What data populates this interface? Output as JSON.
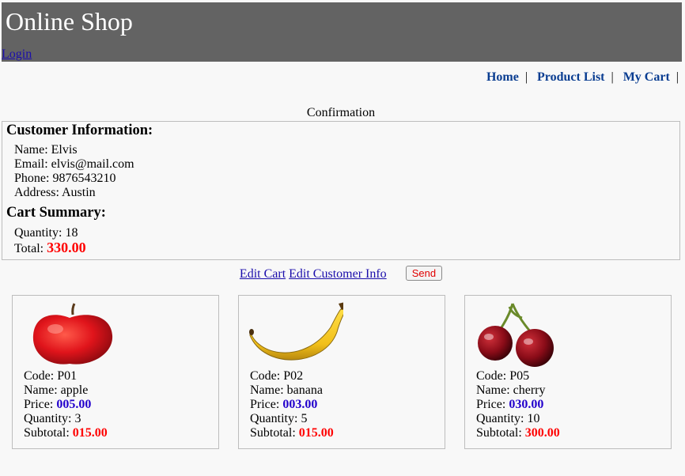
{
  "header": {
    "title": "Online Shop",
    "login_label": "Login"
  },
  "nav": {
    "home": "Home",
    "product_list": "Product List",
    "my_cart": "My Cart",
    "separator": "|"
  },
  "page": {
    "heading": "Confirmation"
  },
  "customer": {
    "section_title": "Customer Information:",
    "name": "Name: Elvis",
    "email": "Email: elvis@mail.com",
    "phone": "Phone: 9876543210",
    "address": "Address: Austin"
  },
  "summary": {
    "section_title": "Cart Summary:",
    "quantity": "Quantity: 18",
    "total_label": "Total:",
    "total_value": "330.00"
  },
  "actions": {
    "edit_cart": "Edit Cart",
    "edit_customer": "Edit Customer Info",
    "send": "Send"
  },
  "items": [
    {
      "image": "apple",
      "code": "Code: P01",
      "name": "Name: apple",
      "price_label": "Price:",
      "price": "005.00",
      "quantity": "Quantity: 3",
      "subtotal_label": "Subtotal:",
      "subtotal": "015.00"
    },
    {
      "image": "banana",
      "code": "Code: P02",
      "name": "Name: banana",
      "price_label": "Price:",
      "price": "003.00",
      "quantity": "Quantity: 5",
      "subtotal_label": "Subtotal:",
      "subtotal": "015.00"
    },
    {
      "image": "cherry",
      "code": "Code: P05",
      "name": "Name: cherry",
      "price_label": "Price:",
      "price": "030.00",
      "quantity": "Quantity: 10",
      "subtotal_label": "Subtotal:",
      "subtotal": "300.00"
    }
  ],
  "colors": {
    "header_bg": "#636363",
    "nav_link": "#0a3d91",
    "price": "#2200cc",
    "subtotal": "#ff0000",
    "total": "#ff0000"
  }
}
